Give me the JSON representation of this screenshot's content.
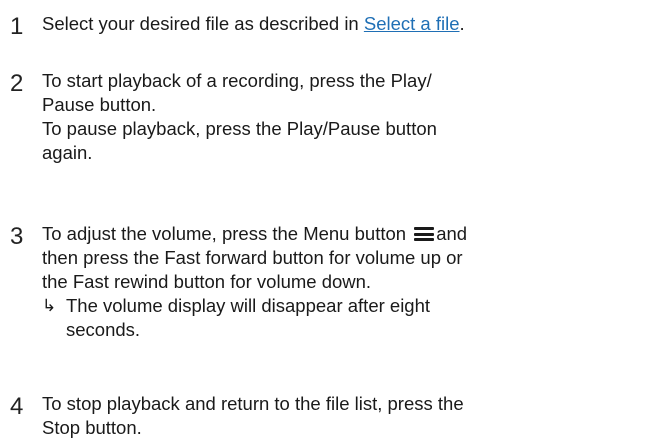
{
  "steps": [
    {
      "number": "1",
      "lines": [
        "Select your desired file as described in ",
        "Select a file",
        "."
      ]
    },
    {
      "number": "2",
      "lines": [
        "To start playback of a recording, press the Play/",
        "Pause button.",
        "To pause playback, press the Play/Pause button",
        "again."
      ]
    },
    {
      "number": "3",
      "line1_before_icon": "To adjust the volume, press the Menu button",
      "line1_after_icon": "and",
      "lines": [
        "then press the Fast forward button for volume up or",
        "the Fast rewind button for volume down."
      ],
      "result_arrow": "↳",
      "result_lines": [
        "The volume display will disappear after eight",
        "seconds."
      ],
      "icon": "menu-icon"
    },
    {
      "number": "4",
      "lines": [
        "To stop playback and return to the file list, press the",
        "Stop button."
      ]
    }
  ]
}
